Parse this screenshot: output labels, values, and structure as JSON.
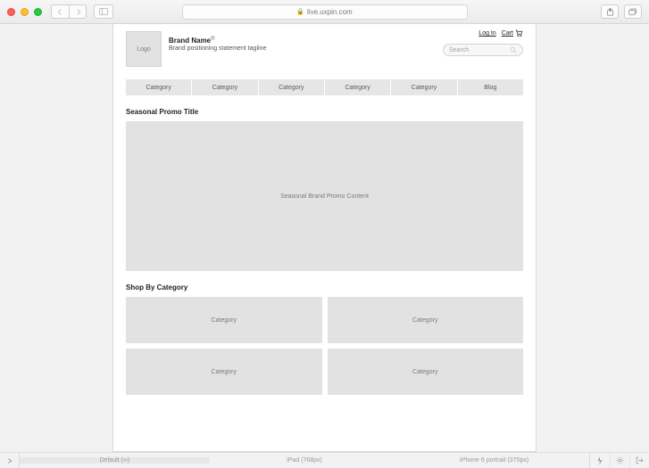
{
  "browser": {
    "url_host": "live.uxpin.com"
  },
  "header": {
    "logo_label": "Logo",
    "brand_name": "Brand Name",
    "registered": "®",
    "tagline": "Brand positioning statement tagline",
    "login_label": "Log In",
    "cart_label": "Cart",
    "search_placeholder": "Search"
  },
  "nav": {
    "items": [
      {
        "label": "Category"
      },
      {
        "label": "Category"
      },
      {
        "label": "Category"
      },
      {
        "label": "Category"
      },
      {
        "label": "Category"
      },
      {
        "label": "Blog"
      }
    ]
  },
  "promo": {
    "title": "Seasonal Promo Title",
    "content": "Seasonal Brand Promo Content"
  },
  "shop": {
    "title": "Shop By Category",
    "cards": [
      {
        "label": "Category"
      },
      {
        "label": "Category"
      },
      {
        "label": "Category"
      },
      {
        "label": "Category"
      }
    ]
  },
  "breakpoints": {
    "bp1": "Default (∞)",
    "bp2": "iPad (768px)",
    "bp3": "iPhone 6 portrait (375px)"
  }
}
